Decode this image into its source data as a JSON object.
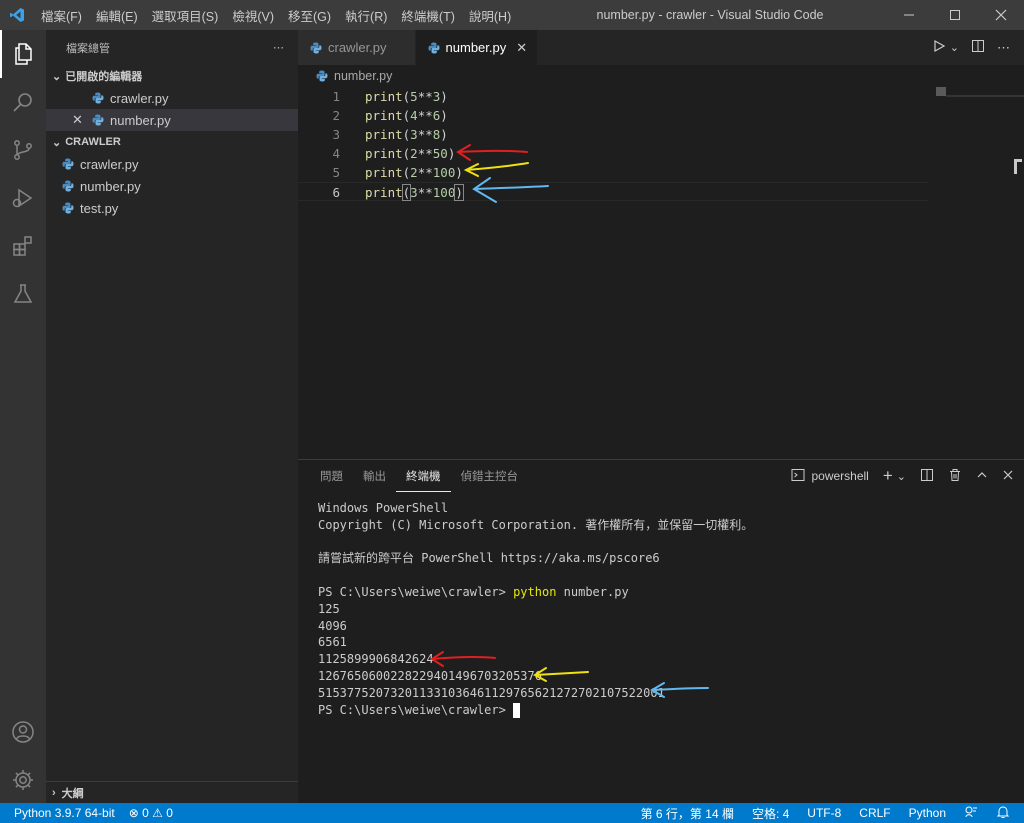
{
  "titlebar": {
    "menu": [
      "檔案(F)",
      "編輯(E)",
      "選取項目(S)",
      "檢視(V)",
      "移至(G)",
      "執行(R)",
      "終端機(T)",
      "說明(H)"
    ],
    "title": "number.py - crawler - Visual Studio Code"
  },
  "sidebar": {
    "header": "檔案總管",
    "open_editors_title": "已開啟的編輯器",
    "open_editors": [
      "crawler.py",
      "number.py"
    ],
    "folder_title": "CRAWLER",
    "files": [
      "crawler.py",
      "number.py",
      "test.py"
    ],
    "outline_title": "大綱"
  },
  "tabs": [
    "crawler.py",
    "number.py"
  ],
  "breadcrumb": "number.py",
  "editor": {
    "lines": [
      {
        "n": "1",
        "fn": "print",
        "pre": "(",
        "a": "5",
        "op": "**",
        "b": "3",
        "post": ")"
      },
      {
        "n": "2",
        "fn": "print",
        "pre": "(",
        "a": "4",
        "op": "**",
        "b": "6",
        "post": ")"
      },
      {
        "n": "3",
        "fn": "print",
        "pre": "(",
        "a": "3",
        "op": "**",
        "b": "8",
        "post": ")"
      },
      {
        "n": "4",
        "fn": "print",
        "pre": "(",
        "a": "2",
        "op": "**",
        "b": "50",
        "post": ")"
      },
      {
        "n": "5",
        "fn": "print",
        "pre": "(",
        "a": "2",
        "op": "**",
        "b": "100",
        "post": ")"
      },
      {
        "n": "6",
        "fn": "print",
        "pre": "(",
        "a": "3",
        "op": "**",
        "b": "100",
        "post": ")"
      }
    ]
  },
  "panel": {
    "tabs": [
      "問題",
      "輸出",
      "終端機",
      "偵錯主控台"
    ],
    "shell": "powershell",
    "terminal": {
      "line1": "Windows PowerShell",
      "line2": "Copyright (C) Microsoft Corporation. 著作權所有，並保留一切權利。",
      "line3": "請嘗試新的跨平台 PowerShell https://aka.ms/pscore6",
      "prompt": "PS C:\\Users\\weiwe\\crawler> ",
      "command": "python",
      "command_arg": " number.py",
      "outputs": [
        "125",
        "4096",
        "6561",
        "1125899906842624",
        "1267650600228229401496703205376",
        "515377520732011331036461129765621272702107522001"
      ],
      "final_prompt": "PS C:\\Users\\weiwe\\crawler> "
    }
  },
  "statusbar": {
    "python": "Python 3.9.7 64-bit",
    "errors": "0",
    "warnings": "0",
    "position": "第 6 行，第 14 欄",
    "spaces": "空格: 4",
    "encoding": "UTF-8",
    "eol": "CRLF",
    "language": "Python"
  },
  "colors": {
    "accent": "#007acc",
    "arrow_red": "#e02020",
    "arrow_yellow": "#f0e010",
    "arrow_blue": "#60b8f0"
  }
}
